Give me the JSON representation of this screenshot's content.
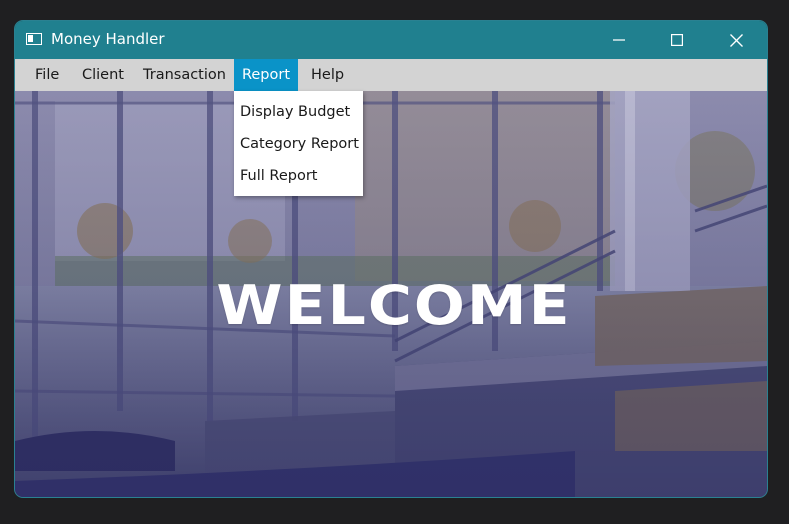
{
  "window": {
    "title": "Money Handler",
    "accent_color": "#20808f"
  },
  "titlebar": {
    "app_icon": "window-icon",
    "minimize_icon": "minimize-icon",
    "maximize_icon": "maximize-icon",
    "close_icon": "close-icon"
  },
  "menubar": {
    "items": [
      {
        "label": "File"
      },
      {
        "label": "Client"
      },
      {
        "label": "Transaction"
      },
      {
        "label": "Report",
        "active": true
      },
      {
        "label": "Help"
      }
    ],
    "active_color": "#0a93c8"
  },
  "report_menu": {
    "items": [
      {
        "label": "Display Budget"
      },
      {
        "label": "Category Report"
      },
      {
        "label": "Full Report"
      }
    ]
  },
  "main": {
    "welcome_text": "WELCOME"
  }
}
